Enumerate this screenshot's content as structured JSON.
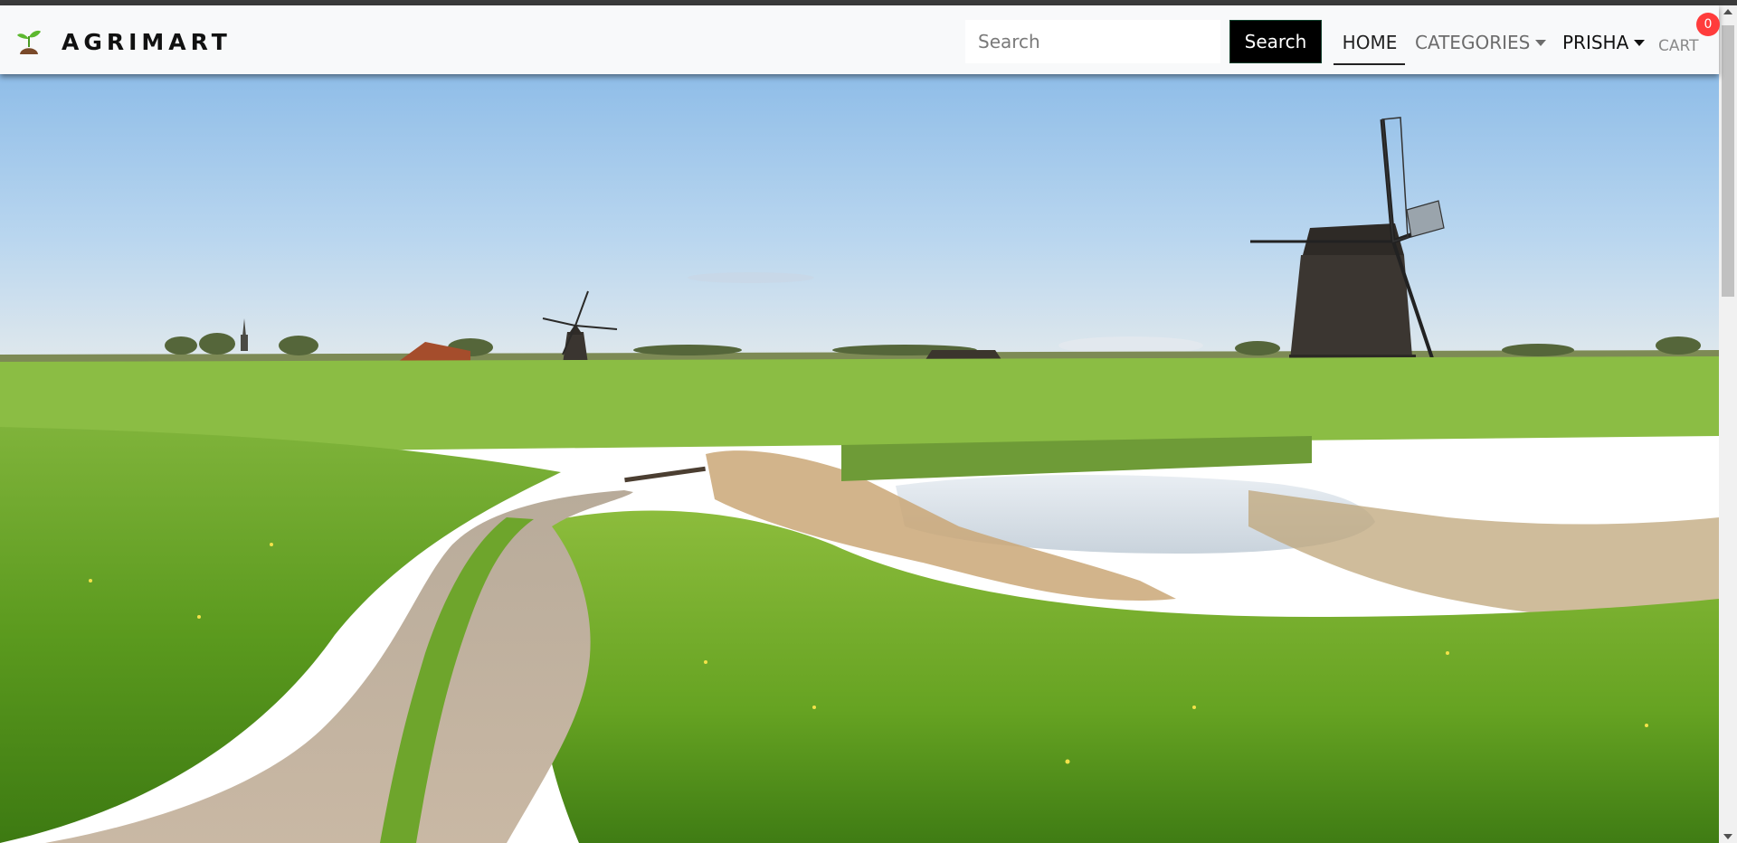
{
  "brand": {
    "name": "AGRIMART",
    "icon": "sprout-icon"
  },
  "search": {
    "placeholder": "Search",
    "value": "",
    "button_label": "Search"
  },
  "nav": {
    "home": "HOME",
    "categories": "CATEGORIES",
    "user": "PRISHA",
    "cart": "CART",
    "cart_count": "0"
  },
  "colors": {
    "navbar_bg": "#f8f9fa",
    "search_button_bg": "#000000",
    "badge": "#ff3c3c",
    "brand_leaf": "#5cb82e",
    "brand_soil": "#7a4a2a"
  },
  "hero": {
    "icon": "windmill-landscape-image"
  }
}
